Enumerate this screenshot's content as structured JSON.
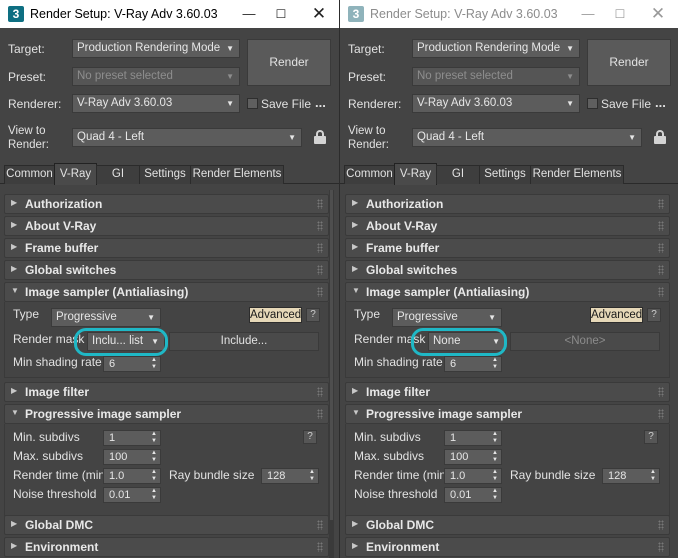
{
  "colors": {
    "window_bg": "#444444",
    "titlebar_bg": "#ffffff",
    "advanced_button_bg": "#e6d8b8",
    "annotation_circle": "#1fb8c6"
  },
  "windows": [
    {
      "title": "Render Setup: V-Ray Adv 3.60.03",
      "app_icon": "3",
      "controls": {
        "minimize": "—",
        "maximize": "☐",
        "close": "✕"
      },
      "target_label": "Target:",
      "target_value": "Production Rendering Mode",
      "preset_label": "Preset:",
      "preset_value": "No preset selected",
      "renderer_label": "Renderer:",
      "renderer_value": "V-Ray Adv 3.60.03",
      "render_button": "Render",
      "save_file_label": "Save File",
      "save_file_checked": false,
      "more_dots": "...",
      "view_label_1": "View to",
      "view_label_2": "Render:",
      "view_value": "Quad 4 - Left",
      "lock_icon": "lock-icon",
      "tabs": [
        "Common",
        "V-Ray",
        "GI",
        "Settings",
        "Render Elements"
      ],
      "active_tab": "V-Ray",
      "rollouts": {
        "authorization": "Authorization",
        "about": "About V-Ray",
        "frame_buffer": "Frame buffer",
        "global_switches": "Global switches",
        "image_sampler": "Image sampler (Antialiasing)",
        "image_filter": "Image filter",
        "progressive": "Progressive image sampler",
        "global_dmc": "Global DMC",
        "environment": "Environment"
      },
      "image_sampler": {
        "type_label": "Type",
        "type_value": "Progressive",
        "advanced_button": "Advanced",
        "help": "?",
        "render_mask_label": "Render mask",
        "render_mask_value": "Inclu... list",
        "mask_field": "Include...",
        "min_shading_label": "Min shading rate",
        "min_shading_value": "6"
      },
      "progressive": {
        "min_subdivs_label": "Min. subdivs",
        "min_subdivs": "1",
        "help": "?",
        "max_subdivs_label": "Max. subdivs",
        "max_subdivs": "100",
        "render_time_label": "Render time (min)",
        "render_time": "1.0",
        "ray_bundle_label": "Ray bundle size",
        "ray_bundle": "128",
        "noise_label": "Noise threshold",
        "noise": "0.01"
      }
    },
    {
      "title": "Render Setup: V-Ray Adv 3.60.03",
      "app_icon": "3",
      "controls": {
        "minimize": "—",
        "maximize": "☐",
        "close": "✕"
      },
      "target_label": "Target:",
      "target_value": "Production Rendering Mode",
      "preset_label": "Preset:",
      "preset_value": "No preset selected",
      "renderer_label": "Renderer:",
      "renderer_value": "V-Ray Adv 3.60.03",
      "render_button": "Render",
      "save_file_label": "Save File",
      "save_file_checked": false,
      "more_dots": "...",
      "view_label_1": "View to",
      "view_label_2": "Render:",
      "view_value": "Quad 4 - Left",
      "lock_icon": "lock-icon",
      "tabs": [
        "Common",
        "V-Ray",
        "GI",
        "Settings",
        "Render Elements"
      ],
      "active_tab": "V-Ray",
      "rollouts": {
        "authorization": "Authorization",
        "about": "About V-Ray",
        "frame_buffer": "Frame buffer",
        "global_switches": "Global switches",
        "image_sampler": "Image sampler (Antialiasing)",
        "image_filter": "Image filter",
        "progressive": "Progressive image sampler",
        "global_dmc": "Global DMC",
        "environment": "Environment"
      },
      "image_sampler": {
        "type_label": "Type",
        "type_value": "Progressive",
        "advanced_button": "Advanced",
        "help": "?",
        "render_mask_label": "Render mask",
        "render_mask_value": "None",
        "mask_field": "<None>",
        "min_shading_label": "Min shading rate",
        "min_shading_value": "6"
      },
      "progressive": {
        "min_subdivs_label": "Min. subdivs",
        "min_subdivs": "1",
        "help": "?",
        "max_subdivs_label": "Max. subdivs",
        "max_subdivs": "100",
        "render_time_label": "Render time (min)",
        "render_time": "1.0",
        "ray_bundle_label": "Ray bundle size",
        "ray_bundle": "128",
        "noise_label": "Noise threshold",
        "noise": "0.01"
      }
    }
  ]
}
